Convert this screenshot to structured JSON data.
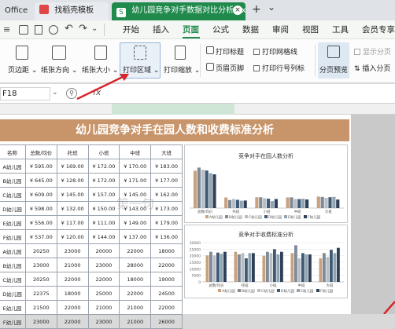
{
  "tabs": {
    "office_label": "Office",
    "template_tab": "找稻壳模板",
    "file_tab": "幼儿园竞争对手数据对比分析1.xlsx",
    "file_tab_short": "幼儿园竞争对手数据对比分析1.xls",
    "add_tab": "+",
    "more_tab": "⌄"
  },
  "menu": {
    "start": "开始",
    "insert": "插入",
    "page": "页面",
    "formula": "公式",
    "data": "数据",
    "review": "审阅",
    "view": "视图",
    "tools": "工具",
    "member": "会员专享"
  },
  "ribbon": {
    "margins": "页边距",
    "orientation": "纸张方向",
    "size": "纸张大小",
    "print_area": "打印区域",
    "print_scale": "打印缩放",
    "print_titles": "打印标题",
    "header_footer": "页眉页脚",
    "print_gridlines": "打印网格线",
    "print_headings": "打印行号列标",
    "page_break_preview": "分页预览",
    "show_page_breaks": "显示分页",
    "insert_page_break": "插入分页"
  },
  "formula": {
    "cell_ref": "F18",
    "fx": "fx"
  },
  "sheet": {
    "title": "幼儿园竞争对手在园人数和收费标准分析",
    "headers": [
      "名称",
      "总数/均价",
      "托班",
      "小班",
      "中班",
      "大班"
    ],
    "rows": [
      [
        "A幼儿园",
        "¥ 595.00",
        "¥ 169.00",
        "¥ 172.00",
        "¥ 170.00",
        "¥ 183.00"
      ],
      [
        "B幼儿园",
        "¥ 645.00",
        "¥ 128.00",
        "¥ 172.00",
        "¥ 171.00",
        "¥ 177.00"
      ],
      [
        "C幼儿园",
        "¥ 609.00",
        "¥ 145.00",
        "¥ 157.00",
        "¥ 145.00",
        "¥ 162.00"
      ],
      [
        "D幼儿园",
        "¥ 598.00",
        "¥ 132.00",
        "¥ 150.00",
        "¥ 143.00",
        "¥ 173.00"
      ],
      [
        "E幼儿园",
        "¥ 556.00",
        "¥ 117.00",
        "¥ 111.00",
        "¥ 149.00",
        "¥ 179.00"
      ],
      [
        "F幼儿园",
        "¥ 537.00",
        "¥ 120.00",
        "¥ 144.00",
        "¥ 137.00",
        "¥ 136.00"
      ],
      [
        "A幼儿园",
        "20250",
        "23000",
        "20000",
        "22000",
        "18000"
      ],
      [
        "B幼儿园",
        "23000",
        "21000",
        "23000",
        "28000",
        "22000"
      ],
      [
        "C幼儿园",
        "20250",
        "22000",
        "22000",
        "18000",
        "19000"
      ],
      [
        "D幼儿园",
        "22375",
        "18000",
        "25000",
        "22000",
        "24500"
      ],
      [
        "E幼儿园",
        "21500",
        "22000",
        "21000",
        "21000",
        "22000"
      ],
      [
        "F幼儿园",
        "23000",
        "22000",
        "23000",
        "21000",
        "26000"
      ]
    ]
  },
  "chart1": {
    "title": "竞争对手在园人数分析",
    "categories": [
      "总数/均价",
      "托班",
      "小班",
      "中班",
      "大班"
    ],
    "legend": [
      "A幼儿园",
      "B幼儿园",
      "C幼儿园",
      "D幼儿园",
      "E幼儿园",
      "F幼儿园"
    ],
    "values": [
      [
        595,
        645,
        609,
        598,
        556,
        537
      ],
      [
        169,
        128,
        145,
        132,
        117,
        120
      ],
      [
        172,
        172,
        157,
        150,
        111,
        144
      ],
      [
        170,
        171,
        145,
        143,
        149,
        137
      ],
      [
        183,
        177,
        162,
        173,
        179,
        136
      ]
    ],
    "ymax": 700
  },
  "chart2": {
    "title": "竞争对手收费标准分析",
    "categories": [
      "总数/均价",
      "托班",
      "小班",
      "中班",
      "大班"
    ],
    "legend": [
      "A幼儿园",
      "B幼儿园",
      "C幼儿园",
      "D幼儿园",
      "E幼儿园",
      "F幼儿园"
    ],
    "values": [
      [
        20250,
        23000,
        20250,
        22375,
        21500,
        23000
      ],
      [
        23000,
        21000,
        22000,
        18000,
        22000,
        22000
      ],
      [
        20000,
        23000,
        22000,
        25000,
        21000,
        23000
      ],
      [
        22000,
        28000,
        18000,
        22000,
        21000,
        21000
      ],
      [
        18000,
        22000,
        19000,
        24500,
        22000,
        26000
      ]
    ],
    "ymax": 30000,
    "yticks": [
      "30000",
      "25000",
      "20000",
      "15000",
      "10000",
      "5000",
      "0"
    ]
  },
  "colors": {
    "series": [
      "#c8a27f",
      "#7f8a96",
      "#b7bec6",
      "#3f5a73",
      "#8fa3b3",
      "#2e4057"
    ],
    "title_bg": "#c8956a",
    "accent_green": "#1f8a4c",
    "arrow": "#d7262b"
  },
  "watermark": "第一句"
}
